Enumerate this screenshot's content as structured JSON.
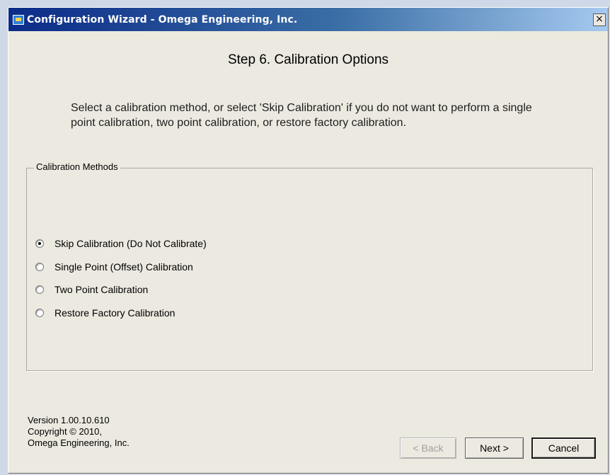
{
  "window": {
    "title": "Configuration Wizard - Omega Engineering, Inc.",
    "close_symbol": "×"
  },
  "step_heading": "Step 6.  Calibration Options",
  "instructions": "Select a calibration method, or select 'Skip Calibration' if you do not want to perform a single point calibration, two point calibration, or restore factory calibration.",
  "calibration_methods": {
    "legend": "Calibration Methods",
    "selected_index": 0,
    "options": [
      "Skip Calibration (Do Not Calibrate)",
      "Single Point (Offset) Calibration",
      "Two Point Calibration",
      "Restore Factory Calibration"
    ]
  },
  "footer": {
    "version": "Version 1.00.10.610",
    "copyright": "Copyright © 2010,",
    "company": "Omega Engineering, Inc."
  },
  "buttons": {
    "back": "< Back",
    "next": "Next >",
    "cancel": "Cancel"
  },
  "colors": {
    "titlebar_start": "#0b2b88",
    "titlebar_end": "#a6caf0",
    "window_bg": "#ece9e0"
  }
}
